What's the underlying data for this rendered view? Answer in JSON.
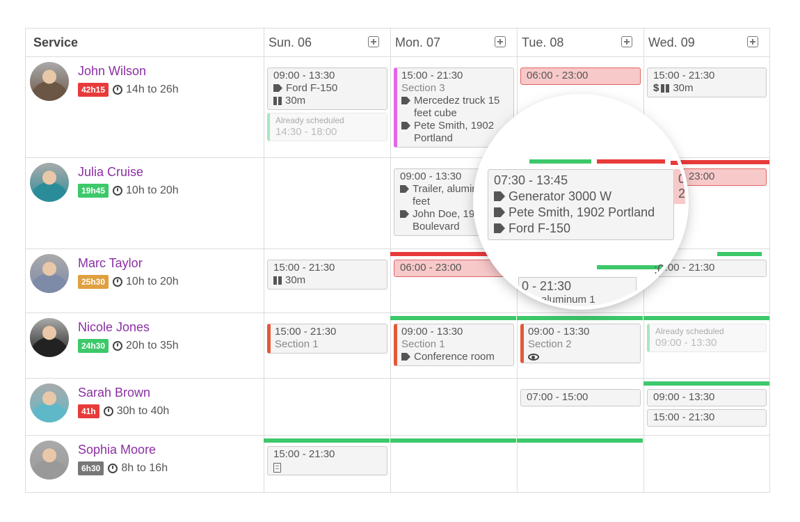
{
  "header": {
    "service_label": "Service",
    "days": [
      "Sun. 06",
      "Mon. 07",
      "Tue. 08",
      "Wed. 09"
    ]
  },
  "colors": {
    "name": "#8b2fa3",
    "red": "#e83a3a",
    "green": "#3dc86a",
    "orange": "#e0a040",
    "gray": "#777",
    "magenta": "#e466e8",
    "section": "#e05a3a"
  },
  "rows": [
    {
      "name": "John Wilson",
      "badge": "42h15",
      "badge_color": "#e83a3a",
      "range": "14h to 26h",
      "avatar": "#6b5646",
      "cells": [
        [
          {
            "type": "normal",
            "lines": [
              {
                "text": "09:00 - 13:30"
              },
              {
                "icon": "tag",
                "text": "Ford F-150"
              },
              {
                "icon": "pause",
                "text": "30m"
              }
            ]
          },
          {
            "type": "ghost",
            "lines": [
              {
                "text": "Already scheduled",
                "style": "small"
              },
              {
                "text": "14:30 - 18:00"
              }
            ]
          }
        ],
        [
          {
            "type": "accent",
            "accent": "#e466e8",
            "lines": [
              {
                "text": "15:00 - 21:30"
              },
              {
                "text": "Section 3",
                "style": "muted"
              },
              {
                "icon": "tag",
                "text": "Mercedez truck 15 feet cube"
              },
              {
                "icon": "tag",
                "text": "Pete Smith, 1902 Portland"
              }
            ]
          }
        ],
        [
          {
            "type": "red",
            "lines": [
              {
                "text": "06:00 - 23:00"
              }
            ]
          }
        ],
        [
          {
            "type": "normal",
            "lines": [
              {
                "text": "15:00 - 21:30"
              },
              {
                "icon": "dollar",
                "text": "30m",
                "pause": true
              }
            ]
          }
        ]
      ]
    },
    {
      "name": "Julia Cruise",
      "badge": "19h45",
      "badge_color": "#3dc86a",
      "range": "10h to 20h",
      "avatar": "#2a8c99",
      "cells": [
        [],
        [
          {
            "type": "normal",
            "lines": [
              {
                "text": "09:00 - 13:30"
              },
              {
                "icon": "tag",
                "text": "Trailer, aluminum feet"
              },
              {
                "icon": "tag",
                "text": "John Doe, 193 Boulevard"
              }
            ]
          }
        ],
        [],
        [
          {
            "type": "red",
            "lines": [
              {
                "text": "06:00 - 23:00"
              }
            ]
          }
        ]
      ]
    },
    {
      "name": "Marc Taylor",
      "badge": "25h30",
      "badge_color": "#e0a040",
      "range": "10h to 20h",
      "avatar": "#7d8aa8",
      "cells": [
        [
          {
            "type": "normal",
            "lines": [
              {
                "text": "15:00 - 21:30"
              },
              {
                "icon": "pause",
                "text": "30m"
              }
            ]
          }
        ],
        [
          {
            "type": "red",
            "lines": [
              {
                "text": "06:00 - 23:00"
              }
            ]
          }
        ],
        [
          {
            "type": "normal",
            "lines": [
              {
                "text": "15:00 - 21:30"
              }
            ]
          }
        ],
        [
          {
            "type": "normal",
            "lines": [
              {
                "text": "15:00 - 21:30"
              }
            ]
          }
        ]
      ]
    },
    {
      "name": "Nicole Jones",
      "badge": "24h30",
      "badge_color": "#3dc86a",
      "range": "20h to 35h",
      "avatar": "#222",
      "cells": [
        [
          {
            "type": "accent",
            "accent": "#e05a3a",
            "lines": [
              {
                "text": "15:00 - 21:30"
              },
              {
                "text": "Section 1",
                "style": "muted"
              }
            ]
          }
        ],
        [
          {
            "type": "accent",
            "accent": "#e05a3a",
            "lines": [
              {
                "text": "09:00 - 13:30"
              },
              {
                "text": "Section 1",
                "style": "muted"
              },
              {
                "icon": "tag",
                "text": "Conference room"
              }
            ]
          }
        ],
        [
          {
            "type": "accent",
            "accent": "#e05a3a",
            "lines": [
              {
                "text": "09:00 - 13:30"
              },
              {
                "text": "Section 2",
                "style": "muted"
              },
              {
                "icon": "eye",
                "text": ""
              }
            ]
          }
        ],
        [
          {
            "type": "ghost",
            "lines": [
              {
                "text": "Already scheduled",
                "style": "small"
              },
              {
                "text": "09:00 - 13:30"
              }
            ]
          }
        ]
      ]
    },
    {
      "name": "Sarah Brown",
      "badge": "41h",
      "badge_color": "#e83a3a",
      "range": "30h to 40h",
      "avatar": "#5fb8c8",
      "cells": [
        [],
        [],
        [
          {
            "type": "normal",
            "lines": [
              {
                "text": "07:00 - 15:00"
              }
            ]
          }
        ],
        [
          {
            "type": "normal",
            "lines": [
              {
                "text": "09:00 - 13:30"
              }
            ]
          },
          {
            "type": "normal",
            "lines": [
              {
                "text": "15:00 - 21:30"
              }
            ]
          }
        ]
      ]
    },
    {
      "name": "Sophia Moore",
      "badge": "6h30",
      "badge_color": "#777",
      "range": "8h to 16h",
      "avatar": "#999",
      "cells": [
        [
          {
            "type": "normal",
            "lines": [
              {
                "text": "15:00 - 21:30"
              },
              {
                "icon": "doc",
                "text": ""
              }
            ]
          }
        ],
        [],
        [],
        []
      ]
    }
  ],
  "magnifier": {
    "time": "07:30 - 13:45",
    "tags": [
      "Generator 3000 W",
      "Pete Smith, 1902 Portland",
      "Ford F-150"
    ],
    "fragments": [
      "0 - 23:00",
      "0 - 21:30",
      ":00 - 21:30",
      "aluminum 1"
    ]
  }
}
